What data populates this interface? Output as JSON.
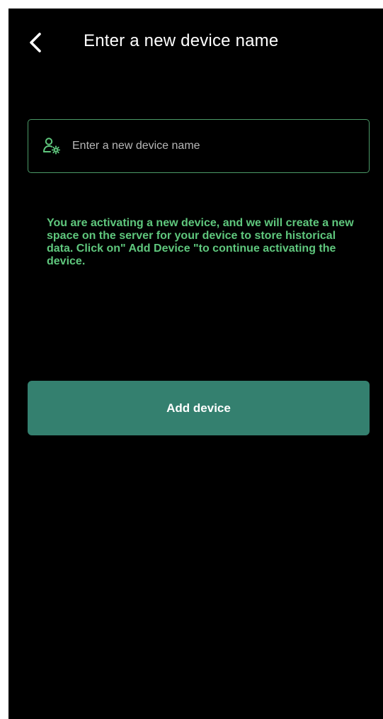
{
  "header": {
    "back_icon": "chevron-left-icon",
    "title": "Enter a new device name"
  },
  "form": {
    "icon": "user-gear-icon",
    "device_name_value": "",
    "device_name_placeholder": "Enter a new device name"
  },
  "info": {
    "text": "You are activating a new device, and we will create a new space on the server for your device to store historical data. Click on\" Add Device \"to continue activating the device."
  },
  "actions": {
    "add_device_label": "Add device"
  },
  "colors": {
    "background": "#000000",
    "accent_green": "#5fc77d",
    "input_border": "#4b9a67",
    "button_bg": "#34806f",
    "text_primary": "#ffffff"
  }
}
